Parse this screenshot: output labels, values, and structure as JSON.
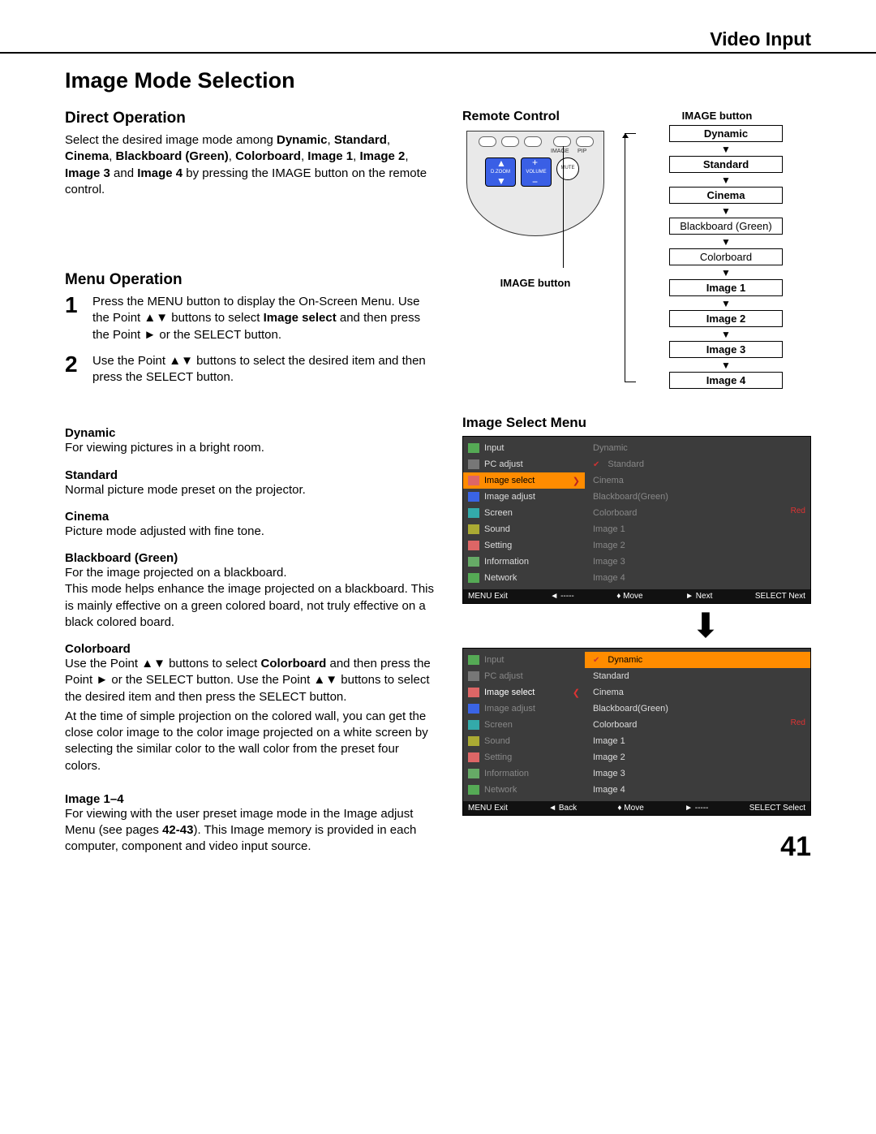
{
  "header": {
    "section": "Video Input"
  },
  "title": "Image Mode Selection",
  "direct_operation": {
    "heading": "Direct Operation",
    "p1a": "Select the desired image mode among ",
    "modes": [
      "Dynamic",
      "Standard",
      "Cinema",
      "Blackboard (Green)",
      "Colorboard",
      "Image 1",
      "Image 2",
      "Image 3",
      "Image 4"
    ],
    "sep": ", ",
    "and": " and ",
    "p1b": " by pressing the IMAGE button on the remote control."
  },
  "menu_operation": {
    "heading": "Menu Operation",
    "step1_a": "Press the MENU button to display the On-Screen Menu. Use the Point ▲▼ buttons to select ",
    "step1_bold": "Image select",
    "step1_b": " and then press the Point ► or the SELECT button.",
    "step2": "Use the Point ▲▼ buttons to select the desired item and then press the SELECT button."
  },
  "modes": {
    "dynamic": {
      "label": "Dynamic",
      "desc": "For viewing pictures in a bright room."
    },
    "standard": {
      "label": "Standard",
      "desc": "Normal picture mode preset on the projector."
    },
    "cinema": {
      "label": "Cinema",
      "desc": "Picture mode adjusted with fine tone."
    },
    "blackboard": {
      "label": "Blackboard (Green)",
      "desc": "For the image projected on a blackboard.\nThis mode helps enhance the image projected on a blackboard. This is mainly effective on a green colored board, not truly effective on a black colored board."
    },
    "colorboard": {
      "label": "Colorboard",
      "p1a": "Use the Point ▲▼ buttons to select ",
      "p1bold": "Colorboard",
      "p1b": " and then press the Point ► or the SELECT button. Use the Point ▲▼ buttons to select the desired item and then press the SELECT button.",
      "p2": "At the time of simple projection on the colored wall, you can get the close color image to the color image projected on a white screen by selecting the similar color to the wall color from the preset four colors."
    },
    "image14": {
      "label": "Image 1–4",
      "p_a": "For viewing with the user preset image mode in the Image adjust Menu (see pages ",
      "p_bold": "42-43",
      "p_b": "). This Image memory is provided in each computer, component and video input source."
    }
  },
  "remote": {
    "heading": "Remote Control",
    "caption": "IMAGE button",
    "btn_labels": {
      "image": "IMAGE",
      "pip": "PIP",
      "dzoom": "D.ZOOM",
      "volume": "VOLUME",
      "mute": "MUTE"
    }
  },
  "cycle": {
    "title": "IMAGE button",
    "items": [
      "Dynamic",
      "Standard",
      "Cinema",
      "Blackboard (Green)",
      "Colorboard",
      "Image 1",
      "Image 2",
      "Image 3",
      "Image 4"
    ]
  },
  "ism": {
    "heading": "Image Select Menu",
    "left_items": [
      "Input",
      "PC adjust",
      "Image select",
      "Image adjust",
      "Screen",
      "Sound",
      "Setting",
      "Information",
      "Network"
    ],
    "right_items": [
      "Dynamic",
      "Standard",
      "Cinema",
      "Blackboard(Green)",
      "Colorboard",
      "Image 1",
      "Image 2",
      "Image 3",
      "Image 4"
    ],
    "red_label": "Red",
    "foot1": {
      "exit": "MENU Exit",
      "back": "◄ -----",
      "move": "♦ Move",
      "next": "► Next",
      "sel": "SELECT Next"
    },
    "foot2": {
      "exit": "MENU Exit",
      "back": "◄ Back",
      "move": "♦ Move",
      "next": "► -----",
      "sel": "SELECT Select"
    }
  },
  "page_number": "41"
}
